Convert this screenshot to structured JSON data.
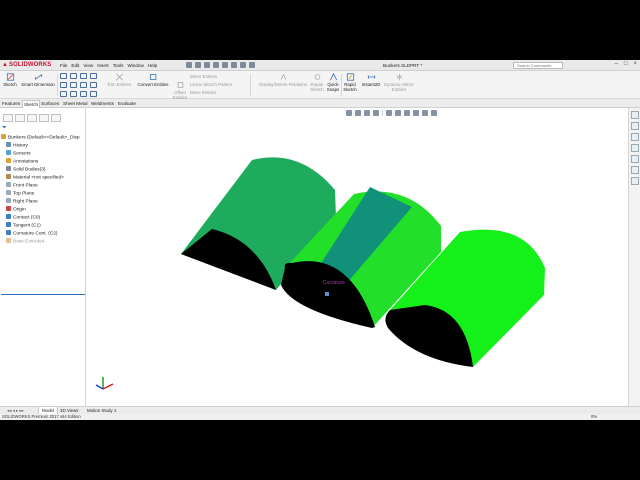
{
  "app": {
    "brand": "SOLIDWORKS",
    "menus": [
      "File",
      "Edit",
      "View",
      "Insert",
      "Tools",
      "Window",
      "Help"
    ],
    "document_title": "Bunkers.SLDPRT *",
    "search_placeholder": "Search Commands",
    "window_controls": [
      "–",
      "□",
      "×"
    ]
  },
  "command_manager": {
    "sketch": "Sketch",
    "smart_dimension": "Smart Dimension",
    "trim_entities": "Trim Entities",
    "convert_entities": "Convert Entities",
    "offset_entities": "Offset Entities",
    "offset_on_surface": "Offset On Surface",
    "mirror_entities": "Mirror Entities",
    "linear_sketch_pattern": "Linear Sketch Pattern",
    "move_entities": "Move Entities",
    "display_delete_relations": "Display/Delete Relations",
    "repair_sketch": "Repair Sketch",
    "quick_snaps": "Quick Snaps",
    "rapid_sketch": "Rapid Sketch",
    "instant2d": "Instant2D",
    "dynamic_mirror": "Dynamic Mirror Entities"
  },
  "tabs": [
    {
      "label": "Features",
      "active": false
    },
    {
      "label": "Sketch",
      "active": true
    },
    {
      "label": "Surfaces",
      "active": false
    },
    {
      "label": "Sheet Metal",
      "active": false
    },
    {
      "label": "Weldments",
      "active": false
    },
    {
      "label": "Evaluate",
      "active": false
    }
  ],
  "feature_tree": {
    "root": "Bunkers  (Default<<Default>_Disp",
    "items": [
      {
        "label": "History",
        "icon": "history-icon",
        "dim": false
      },
      {
        "label": "Sensors",
        "icon": "sensor-icon",
        "dim": false
      },
      {
        "label": "Annotations",
        "icon": "annotation-icon",
        "dim": false
      },
      {
        "label": "Solid Bodies(3)",
        "icon": "solid-bodies-icon",
        "dim": false
      },
      {
        "label": "Material <not specified>",
        "icon": "material-icon",
        "dim": false
      },
      {
        "label": "Front Plane",
        "icon": "plane-icon",
        "dim": false
      },
      {
        "label": "Top Plane",
        "icon": "plane-icon",
        "dim": false
      },
      {
        "label": "Right Plane",
        "icon": "plane-icon",
        "dim": false
      },
      {
        "label": "Origin",
        "icon": "origin-icon",
        "dim": false
      },
      {
        "label": "Contact (C0)",
        "icon": "surface-icon",
        "dim": false
      },
      {
        "label": "Tangent (C1)",
        "icon": "surface-icon",
        "dim": false
      },
      {
        "label": "Curvature Cont. (C2)",
        "icon": "surface-icon",
        "dim": false
      },
      {
        "label": "Boss-Extrude4",
        "icon": "extrude-icon",
        "dim": true
      }
    ]
  },
  "viewport": {
    "annotation": "Curvature",
    "colors": {
      "body_dark_green": "#1fab5e",
      "body_bright_green": "#22e02a",
      "band_teal": "#11907a",
      "body_lime": "#16f01a",
      "face_black": "#000000"
    }
  },
  "model_tabs": [
    {
      "label": "Model",
      "active": true
    },
    {
      "label": "3D Views",
      "active": false
    },
    {
      "label": "Motion Study 1",
      "active": false
    }
  ],
  "status": {
    "text": "SOLIDWORKS Premium 2017 x64 Edition",
    "zoom": "0%"
  }
}
